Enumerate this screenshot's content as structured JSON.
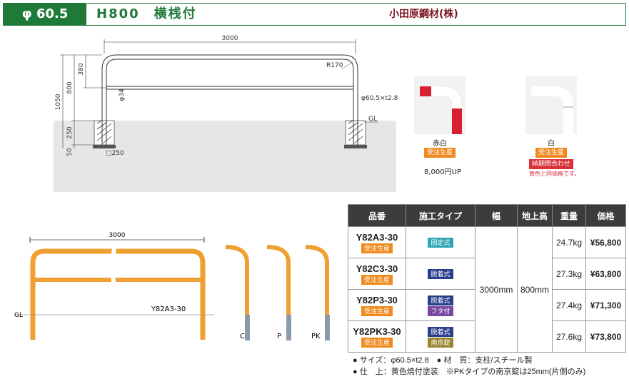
{
  "header": {
    "size": "φ 60.5",
    "title": "H800　横桟付",
    "maker": "小田原鋼材(株)"
  },
  "drawing": {
    "width": "3000",
    "r": "R170",
    "h_total": "1050",
    "h_top": "380",
    "h_800": "800",
    "h_250": "250",
    "h_50": "50",
    "d34": "φ34",
    "pipe": "φ60.5×t2.8",
    "gl": "GL",
    "base": "□250"
  },
  "swatches": [
    {
      "name": "赤白",
      "badges": [
        "受注生産"
      ],
      "price": "8,000円UP",
      "note": ""
    },
    {
      "name": "白",
      "badges": [
        "受注生産",
        "納期問合わせ"
      ],
      "price": "",
      "note": "黄色と同価格です。"
    }
  ],
  "product_drawing": {
    "width": "3000",
    "gl": "GL",
    "model": "Y82A3-30",
    "types": [
      "C",
      "P",
      "PK"
    ]
  },
  "table": {
    "headers": [
      "品番",
      "施工タイプ",
      "幅",
      "地上高",
      "重量",
      "価格"
    ],
    "width": "3000mm",
    "height": "800mm",
    "rows": [
      {
        "code": "Y82A3-30",
        "badge": "受注生産",
        "types": [
          "固定式"
        ],
        "weight": "24.7kg",
        "price": "¥56,800"
      },
      {
        "code": "Y82C3-30",
        "badge": "受注生産",
        "types": [
          "脱着式"
        ],
        "weight": "27.3kg",
        "price": "¥63,800"
      },
      {
        "code": "Y82P3-30",
        "badge": "受注生産",
        "types": [
          "脱着式",
          "フタ付"
        ],
        "weight": "27.4kg",
        "price": "¥71,300"
      },
      {
        "code": "Y82PK3-30",
        "badge": "受注生産",
        "types": [
          "脱着式",
          "南京錠"
        ],
        "weight": "27.6kg",
        "price": "¥73,800"
      }
    ]
  },
  "notes": [
    "● サイズ：φ60.5×t2.8　● 材　質：支柱/スチール製",
    "● 仕　上：黄色焼付塗装　※PKタイプの南京錠は25mm(片側のみ)"
  ]
}
